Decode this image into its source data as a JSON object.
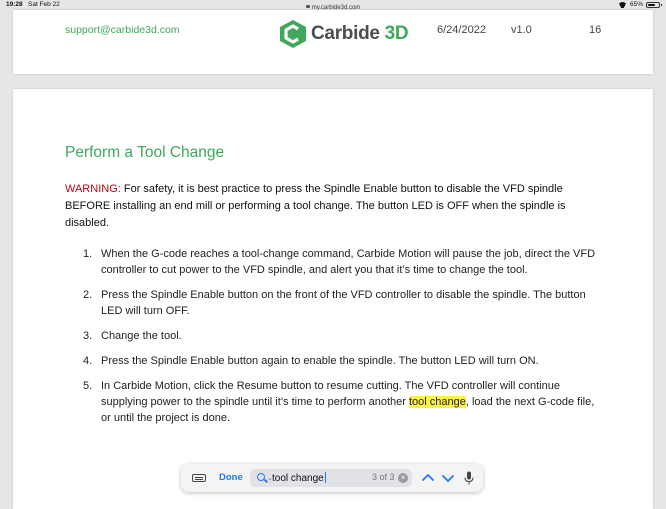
{
  "status_bar": {
    "time": "19:28",
    "date": "Sat Feb 22",
    "url": "my.carbide3d.com",
    "battery": "65%",
    "battery_level": 0.65
  },
  "page_footer": {
    "email": "support@carbide3d.com",
    "logo_text_main": "Carbide",
    "logo_text_accent": "3D",
    "date": "6/24/2022",
    "version": "v1.0",
    "page_number": "16"
  },
  "content": {
    "section_title": "Perform a Tool Change",
    "warning_label": "WARNING:",
    "warning_text": "For safety, it is best practice to press the Spindle Enable button to disable the VFD spindle BEFORE installing an end mill or performing a tool change. The button LED is OFF when the spindle is disabled.",
    "steps": [
      {
        "num": "1.",
        "text": "When the G-code reaches a tool-change command, Carbide Motion will pause the job, direct the VFD controller to cut power to the VFD spindle, and alert you that it’s time to change the tool."
      },
      {
        "num": "2.",
        "text": "Press the Spindle Enable button on the front of the VFD controller to disable the spindle. The button LED will turn OFF."
      },
      {
        "num": "3.",
        "text": "Change the tool."
      },
      {
        "num": "4.",
        "text": "Press the Spindle Enable button again to enable the spindle. The button LED will turn ON."
      },
      {
        "num": "5.",
        "text_before": "In Carbide Motion, click the Resume button to resume cutting. The VFD controller will continue supplying power to the spindle until it’s time to perform another",
        "highlight": "tool change",
        "text_after": ", load the next G-code file, or until the project is done."
      }
    ]
  },
  "find_bar": {
    "done_label": "Done",
    "query": "tool change",
    "match_count": "3 of 3",
    "clear_symbol": "×"
  },
  "colors": {
    "brand_green": "#3fa85b",
    "warning_red": "#c0000f",
    "highlight": "#fff04a",
    "ios_blue": "#1d7bf5"
  },
  "icons": [
    "lock-icon",
    "wifi-icon",
    "battery-icon",
    "carbide-logo-icon",
    "keyboard-icon",
    "search-icon",
    "chevron-down-icon",
    "clear-icon",
    "chevron-up-icon",
    "chevron-down-icon",
    "microphone-icon"
  ]
}
